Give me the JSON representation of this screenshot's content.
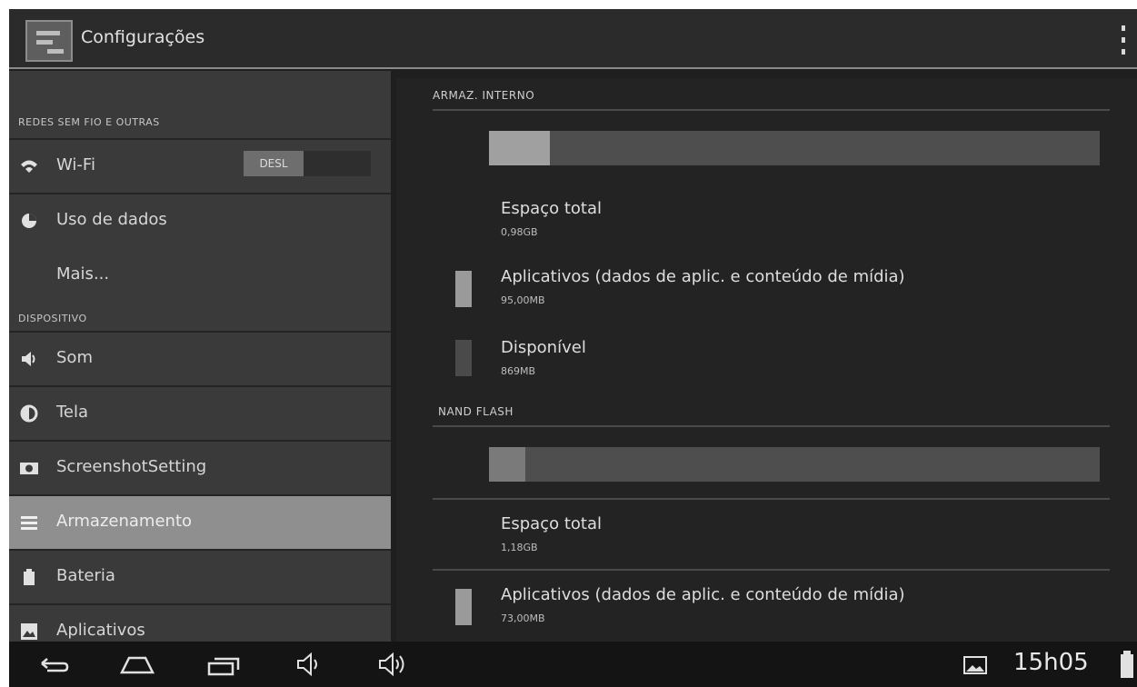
{
  "actionbar": {
    "title": "Configurações"
  },
  "sidebar": {
    "sections": [
      {
        "header": "REDES SEM FIO E OUTRAS"
      },
      {
        "header": "DISPOSITIVO"
      }
    ],
    "items": [
      {
        "label": "Wi-Fi",
        "icon": "wifi-icon"
      },
      {
        "label": "Uso de dados",
        "icon": "data-usage-icon"
      },
      {
        "label": "Mais..."
      },
      {
        "label": "Som",
        "icon": "speaker-icon"
      },
      {
        "label": "Tela",
        "icon": "brightness-icon"
      },
      {
        "label": "ScreenshotSetting",
        "icon": "camera-icon"
      },
      {
        "label": "Armazenamento",
        "icon": "storage-icon",
        "selected": true
      },
      {
        "label": "Bateria",
        "icon": "battery-icon"
      },
      {
        "label": "Aplicativos",
        "icon": "apps-icon"
      }
    ],
    "wifi_toggle": {
      "state": "DESL"
    }
  },
  "storage": {
    "internal": {
      "header": "ARMAZ. INTERNO",
      "used_fraction": 0.1,
      "items": [
        {
          "title": "Espaço total",
          "value": "0,98GB"
        },
        {
          "title": "Aplicativos (dados de aplic. e conteúdo de mídia)",
          "value": "95,00MB",
          "color": "#9a9a9a"
        },
        {
          "title": "Disponível",
          "value": "869MB",
          "color": "#4a4a4a"
        }
      ]
    },
    "nand": {
      "header": "NAND FLASH",
      "used_fraction": 0.06,
      "items": [
        {
          "title": "Espaço total",
          "value": "1,18GB"
        },
        {
          "title": "Aplicativos (dados de aplic. e conteúdo de mídia)",
          "value": "73,00MB",
          "color": "#9a9a9a"
        }
      ]
    }
  },
  "statusbar": {
    "time": "15h05"
  },
  "colors": {
    "selected": "#8f8f8f",
    "panel": "#3a3a3a",
    "content": "#232323"
  }
}
